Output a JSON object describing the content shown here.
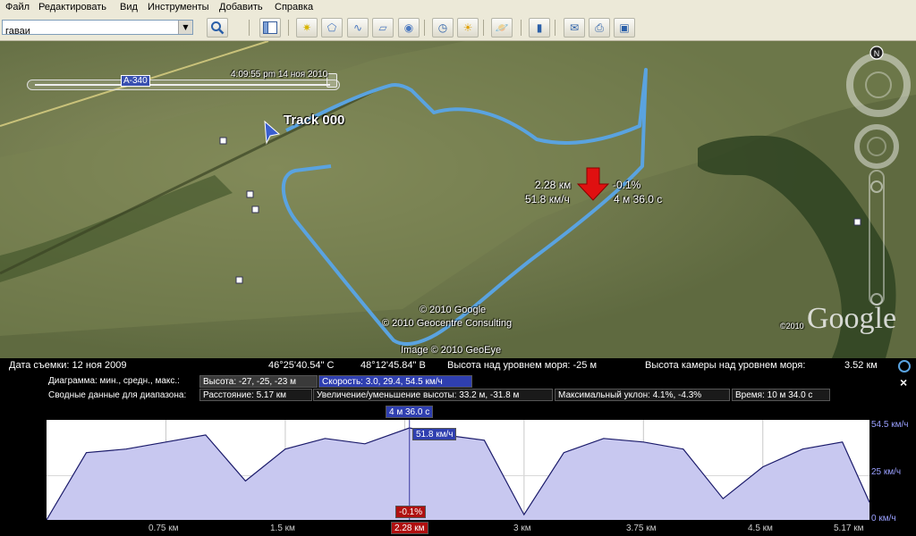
{
  "menu": [
    "Файл",
    "Редактировать",
    "Вид",
    "Инструменты",
    "Добавить",
    "Справка"
  ],
  "search": {
    "value": "гаваи"
  },
  "toolbar_icons": [
    "search-icon",
    "sidebar-toggle-icon",
    "placemark-icon",
    "polygon-icon",
    "path-icon",
    "overlay-icon",
    "record-tour-icon",
    "history-clock-icon",
    "sunlight-icon",
    "planets-icon",
    "ruler-icon",
    "email-icon",
    "print-icon",
    "save-image-icon"
  ],
  "map": {
    "time_label": "4:09:55 pm 14 ноя 2010",
    "road_label": "A-340",
    "track_name": "Track 000",
    "marker": {
      "distance": "2.28 км",
      "speed": "51.8 км/ч",
      "grade": "-0.1%",
      "time": "4 м 36.0 с"
    },
    "credits": [
      "© 2010 Google",
      "© 2010 Geocentre Consulting",
      "Image © 2010 GeoEye"
    ],
    "logo_year": "©2010",
    "logo": "Google",
    "compass": "N"
  },
  "status": {
    "date_label": "Дата съемки: 12 ноя 2009",
    "lat": "46°25'40.54\" С",
    "lon": "48°12'45.84\" В",
    "elevation": "Высота над уровнем моря:  -25 м",
    "eye_alt_label": "Высота камеры над уровнем моря:",
    "eye_alt_value": "3.52 км"
  },
  "profile": {
    "row1_label": "Диаграмма: мин., средн., макс.:",
    "height_chip": "Высота: -27, -25, -23 м",
    "speed_chip": "Скорость: 3.0, 29.4, 54.5 км/ч",
    "row2_label": "Сводные данные для диапазона:",
    "distance_chip": "Расстояние: 5.17 км",
    "gain_chip": "Увеличение/уменьшение высоты: 33.2 м, -31.8 м",
    "slope_chip": "Максимальный уклон: 4.1%, -4.3%",
    "time_chip": "Время: 10 м 34.0 с",
    "cursor_time": "4 м 36.0 с",
    "cursor_speed": "51.8 км/ч",
    "cursor_grade": "-0.1%",
    "cursor_distance": "2.28 км",
    "close": "×",
    "y_ticks": [
      "54.5 км/ч",
      "25 км/ч",
      "0 км/ч"
    ],
    "x_ticks": [
      "0.75 км",
      "1.5 км",
      "3 км",
      "3.75 км",
      "4.5 км",
      "5.17 км"
    ]
  },
  "chart_data": {
    "type": "area",
    "x": [
      0,
      0.25,
      0.5,
      0.75,
      1.0,
      1.25,
      1.5,
      1.75,
      2.0,
      2.28,
      2.5,
      2.75,
      3.0,
      3.25,
      3.5,
      3.75,
      4.0,
      4.25,
      4.5,
      4.75,
      5.0,
      5.17
    ],
    "series": [
      {
        "values": [
          0,
          38,
          40,
          44,
          48,
          22,
          40,
          46,
          43,
          52,
          48,
          45,
          3,
          38,
          46,
          44,
          40,
          12,
          30,
          40,
          44,
          10
        ]
      }
    ],
    "ylim": [
      0,
      54.5
    ],
    "xlim": [
      0,
      5.17
    ]
  }
}
